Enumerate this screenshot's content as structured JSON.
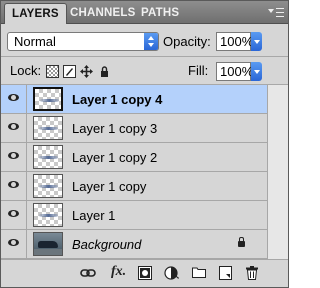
{
  "tabs": [
    {
      "label": "LAYERS",
      "active": true
    },
    {
      "label": "CHANNELS",
      "active": false
    },
    {
      "label": "PATHS",
      "active": false
    }
  ],
  "panel_menu_icon": "panel-menu-icon",
  "blend_mode": {
    "value": "Normal"
  },
  "opacity": {
    "label": "Opacity:",
    "value": "100%"
  },
  "lock": {
    "label": "Lock:",
    "buttons": [
      "lock-transparency-icon",
      "lock-image-pixels-icon",
      "lock-position-icon",
      "lock-all-icon"
    ]
  },
  "fill": {
    "label": "Fill:",
    "value": "100%"
  },
  "layers": [
    {
      "name": "Layer 1 copy 4",
      "selected": true,
      "visible": true
    },
    {
      "name": "Layer 1 copy 3",
      "selected": false,
      "visible": true
    },
    {
      "name": "Layer 1 copy 2",
      "selected": false,
      "visible": true
    },
    {
      "name": "Layer 1 copy",
      "selected": false,
      "visible": true
    },
    {
      "name": "Layer 1",
      "selected": false,
      "visible": true
    },
    {
      "name": "Background",
      "selected": false,
      "visible": true,
      "locked": true
    }
  ],
  "bottom_toolbar": {
    "fx_label": "fx.",
    "icons": [
      "link-layers-icon",
      "layer-style-icon",
      "add-mask-icon",
      "adjustment-layer-icon",
      "new-group-icon",
      "new-layer-icon",
      "delete-layer-icon"
    ]
  },
  "colors": {
    "panel_bg": "#d6d6d6",
    "selection": "#b4d1fb",
    "tabbar": "#7f7f7f",
    "accent_blue": "#2a66d6"
  }
}
